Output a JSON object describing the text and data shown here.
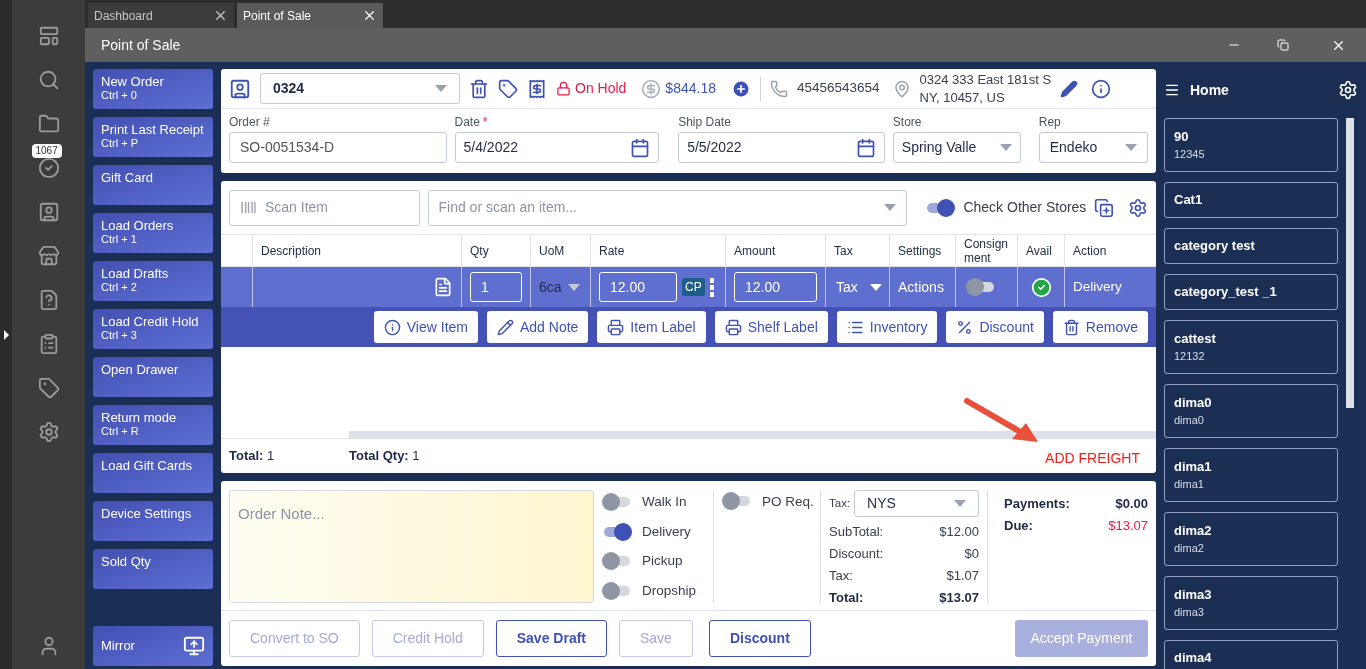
{
  "tabs": [
    {
      "label": "Dashboard",
      "selected": false
    },
    {
      "label": "Point of Sale",
      "selected": true
    }
  ],
  "window": {
    "title": "Point of Sale"
  },
  "rail": {
    "badge": "1067"
  },
  "actions": [
    {
      "label": "New Order",
      "shortcut": "Ctrl + 0"
    },
    {
      "label": "Print Last Receipt",
      "shortcut": "Ctrl + P"
    },
    {
      "label": "Gift Card"
    },
    {
      "label": "Load Orders",
      "shortcut": "Ctrl + 1"
    },
    {
      "label": "Load Drafts",
      "shortcut": "Ctrl + 2"
    },
    {
      "label": "Load Credit Hold",
      "shortcut": "Ctrl + 3"
    },
    {
      "label": "Open Drawer"
    },
    {
      "label": "Return mode",
      "shortcut": "Ctrl + R"
    },
    {
      "label": "Load Gift Cards"
    },
    {
      "label": "Device Settings"
    },
    {
      "label": "Sold Qty"
    }
  ],
  "mirror": {
    "label": "Mirror"
  },
  "header": {
    "customer": "0324",
    "status": "On Hold",
    "balance": "$844.18",
    "phone": "45456543654",
    "address": [
      "0324 333 East 181st S",
      "NY, 10457, US"
    ]
  },
  "fields": {
    "order_no": {
      "label": "Order #",
      "value": "SO-0051534-D"
    },
    "date": {
      "label": "Date",
      "marker": "*",
      "value": "5/4/2022"
    },
    "ship_date": {
      "label": "Ship Date",
      "value": "5/5/2022"
    },
    "store": {
      "label": "Store",
      "value": "Spring Valle"
    },
    "rep": {
      "label": "Rep",
      "value": "Endeko"
    }
  },
  "search": {
    "scan_placeholder": "Scan Item",
    "find_placeholder": "Find or scan an item...",
    "check_other_stores": {
      "label": "Check Other Stores",
      "on": true
    }
  },
  "table": {
    "columns": [
      "Description",
      "Qty",
      "UoM",
      "Rate",
      "Amount",
      "Tax",
      "Settings",
      "Consign ment",
      "Avail",
      "Action"
    ],
    "row": {
      "qty": "1",
      "uom": "6ca",
      "rate": "12.00",
      "cp": "CP",
      "amount": "12.00",
      "tax": "Tax",
      "settings": "Actions",
      "consignment": false,
      "avail": true,
      "action": "Delivery"
    }
  },
  "row_actions": [
    {
      "kind": "view",
      "label": "View Item"
    },
    {
      "kind": "note",
      "label": "Add Note"
    },
    {
      "kind": "print",
      "label": "Item Label"
    },
    {
      "kind": "print",
      "label": "Shelf Label"
    },
    {
      "kind": "list",
      "label": "Inventory"
    },
    {
      "kind": "percent",
      "label": "Discount"
    },
    {
      "kind": "remove",
      "label": "Remove"
    }
  ],
  "totals": [
    {
      "label": "Total:",
      "value": "1"
    },
    {
      "label": "Total Qty:",
      "value": "1"
    }
  ],
  "add_freight": "ADD FREIGHT",
  "note": {
    "placeholder": "Order Note..."
  },
  "fulfillment": [
    {
      "label": "Walk In",
      "on": false
    },
    {
      "label": "Delivery",
      "on": true
    },
    {
      "label": "Pickup",
      "on": false
    },
    {
      "label": "Dropship",
      "on": false
    }
  ],
  "po_req": {
    "label": "PO Req.",
    "on": false
  },
  "tax": {
    "label": "Tax:",
    "value": "NYS"
  },
  "summary": [
    {
      "label": "SubTotal:",
      "value": "$12.00",
      "bold": false
    },
    {
      "label": "Discount:",
      "value": "$0",
      "bold": false
    },
    {
      "label": "Tax:",
      "value": "$1.07",
      "bold": false
    },
    {
      "label": "Total:",
      "value": "$13.07",
      "bold": true
    }
  ],
  "payments": [
    {
      "label": "Payments:",
      "value": "$0.00",
      "due": false
    },
    {
      "label": "Due:",
      "value": "$13.07",
      "due": true
    }
  ],
  "footer_buttons": [
    {
      "label": "Convert to SO",
      "disabled": true
    },
    {
      "label": "Credit Hold",
      "disabled": true
    },
    {
      "label": "Save Draft",
      "disabled": false
    },
    {
      "label": "Save",
      "disabled": true
    },
    {
      "label": "Discount",
      "disabled": false
    }
  ],
  "accept_payment": {
    "label": "Accept Payment",
    "disabled": true
  },
  "home": {
    "label": "Home"
  },
  "tiles": [
    {
      "title": "90",
      "subtitle": "12345"
    },
    {
      "title": "Cat1"
    },
    {
      "title": "category test"
    },
    {
      "title": "category_test _1"
    },
    {
      "title": "cattest",
      "subtitle": "12132"
    },
    {
      "title": "dima0",
      "subtitle": "dima0"
    },
    {
      "title": "dima1",
      "subtitle": "dima1"
    },
    {
      "title": "dima2",
      "subtitle": "dima2"
    },
    {
      "title": "dima3",
      "subtitle": "dima3"
    },
    {
      "title": "dima4"
    }
  ]
}
